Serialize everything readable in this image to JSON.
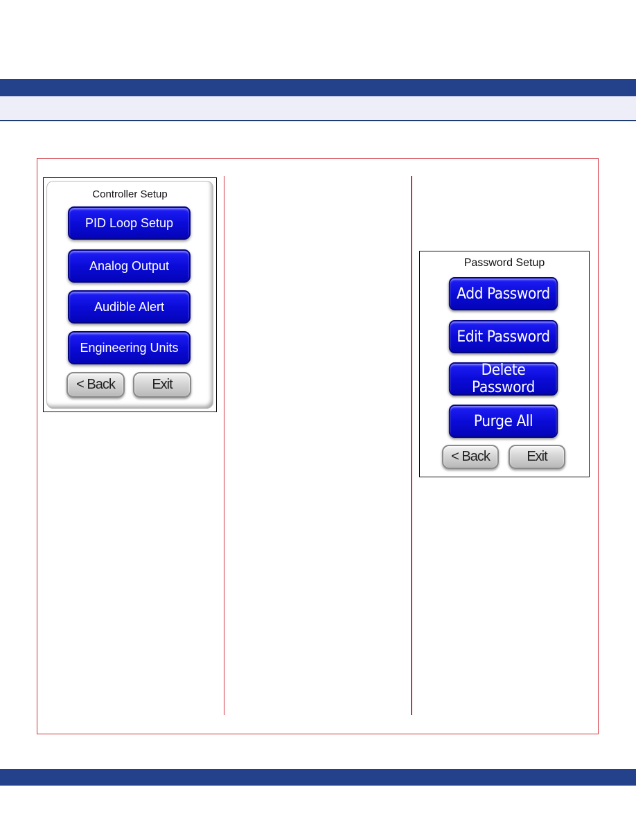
{
  "colors": {
    "band": "#24418c",
    "sub_band": "#eeeef8",
    "frame_border": "#d0313b",
    "button_blue": "#0b0bd8",
    "button_gray": "#cfcfcf"
  },
  "panels": [
    {
      "title": "Controller Setup",
      "buttons": [
        "PID Loop Setup",
        "Analog Output",
        "Audible Alert",
        "Engineering Units"
      ],
      "back_label": "< Back",
      "exit_label": "Exit"
    },
    {
      "title": "Password Setup",
      "buttons": [
        "Add Password",
        "Edit Password",
        "Delete Password",
        "Purge All"
      ],
      "back_label": "< Back",
      "exit_label": "Exit"
    }
  ]
}
